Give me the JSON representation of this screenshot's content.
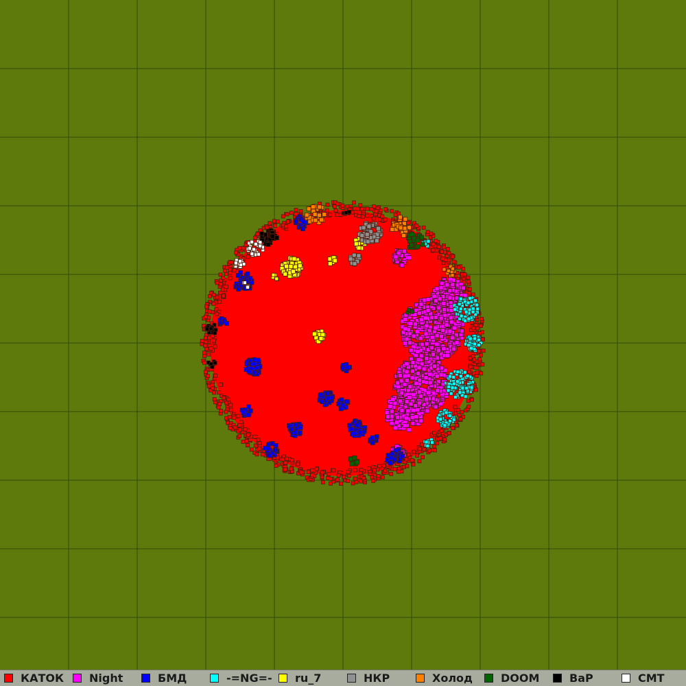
{
  "map": {
    "background_color": "#5e7a0c",
    "grid_color": "#2e4a08",
    "grid_lines_per_axis": 10,
    "outline_color": "#4a1e10"
  },
  "legend": {
    "items": [
      {
        "label": "КАТОК",
        "color": "#ff0000"
      },
      {
        "label": "Night",
        "color": "#ff00ff"
      },
      {
        "label": "БМД",
        "color": "#0000ff"
      },
      {
        "label": "-=NG=-",
        "color": "#00ffff"
      },
      {
        "label": "ru_7",
        "color": "#ffff00"
      },
      {
        "label": "НКР",
        "color": "#909090"
      },
      {
        "label": "Холод",
        "color": "#ff8000"
      },
      {
        "label": "DOOM",
        "color": "#006400"
      },
      {
        "label": "ВаР",
        "color": "#000000"
      },
      {
        "label": "СМТ",
        "color": "#ffffff"
      }
    ]
  }
}
